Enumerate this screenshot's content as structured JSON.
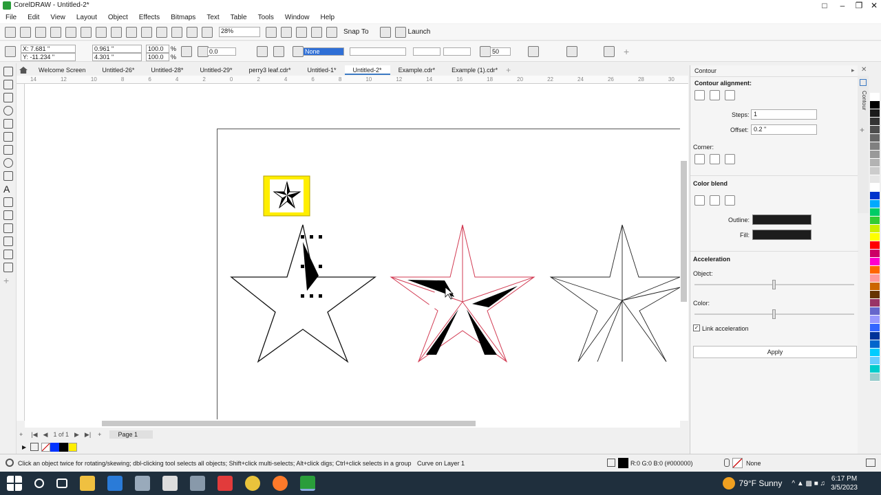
{
  "app": {
    "title": "CorelDRAW - Untitled-2*"
  },
  "menu": [
    "File",
    "Edit",
    "View",
    "Layout",
    "Object",
    "Effects",
    "Bitmaps",
    "Text",
    "Table",
    "Tools",
    "Window",
    "Help"
  ],
  "toolbar": {
    "zoom": "28%",
    "snap_to": "Snap To",
    "launch": "Launch"
  },
  "propbar": {
    "x": "X: 7.681 \"",
    "y": "Y: -11.234 \"",
    "w": "0.961 \"",
    "h": "4.301 \"",
    "sx": "100.0",
    "sy": "100.0",
    "pct": "%",
    "angle": "0.0",
    "outline": "None",
    "size": "50"
  },
  "tabs": [
    "Welcome Screen",
    "Untitled-26*",
    "Untitled-28*",
    "Untitled-29*",
    "perry3 leaf.cdr*",
    "Untitled-1*",
    "Untitled-2*",
    "Example.cdr*",
    "Example (1).cdr*"
  ],
  "active_tab": "Untitled-2*",
  "ruler_labels": [
    "14",
    "12",
    "10",
    "8",
    "6",
    "4",
    "2",
    "0",
    "2",
    "4",
    "6",
    "8",
    "10",
    "12",
    "14",
    "16",
    "18",
    "20",
    "22",
    "24",
    "26",
    "28",
    "30"
  ],
  "pagebar": {
    "count": "1 of 1",
    "page": "Page 1"
  },
  "docker": {
    "title": "Contour",
    "alignment": "Contour alignment:",
    "steps_label": "Steps:",
    "steps": "1",
    "offset_label": "Offset:",
    "offset": "0.2 \"",
    "corner": "Corner:",
    "color_blend": "Color blend",
    "outline_label": "Outline:",
    "fill_label": "Fill:",
    "acceleration": "Acceleration",
    "object_label": "Object:",
    "color_label": "Color:",
    "link": "Link acceleration",
    "apply": "Apply",
    "vtab": "Contour"
  },
  "status": {
    "hint": "Click an object twice for rotating/skewing; dbl-clicking tool selects all objects; Shift+click multi-selects; Alt+click digs; Ctrl+click selects in a group",
    "layer": "Curve on Layer 1",
    "color": "R:0 G:0 B:0 (#000000)",
    "outline": "None"
  },
  "taskbar": {
    "weather": "79°F Sunny",
    "time": "6:17 PM",
    "date": "3/5/2023"
  },
  "colors": {
    "selected_outline": "#d23a52",
    "palette": [
      "#ffffff",
      "#000000",
      "#1a1a1a",
      "#333333",
      "#4d4d4d",
      "#666666",
      "#808080",
      "#999999",
      "#b3b3b3",
      "#cccccc",
      "#e6e6e6",
      "#ffffff",
      "#0033cc",
      "#00aaff",
      "#00cc66",
      "#33cc33",
      "#ccee00",
      "#ffff00",
      "#ff0000",
      "#cc0066",
      "#ff00cc",
      "#ff6600",
      "#ff9999",
      "#cc6600",
      "#663300",
      "#993366",
      "#6666cc",
      "#9999ff",
      "#3366ff",
      "#003399",
      "#0066cc",
      "#00ccff",
      "#66ccff",
      "#00cccc",
      "#99cccc"
    ]
  }
}
